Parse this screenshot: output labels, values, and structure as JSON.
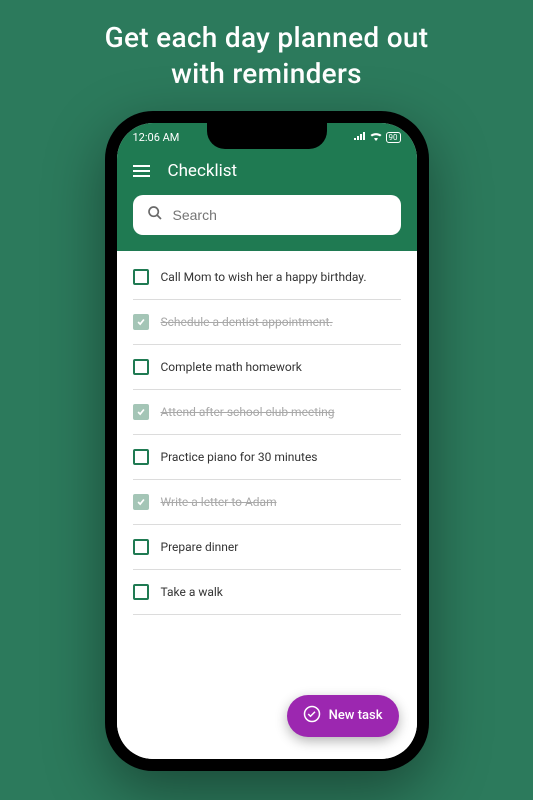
{
  "promo": {
    "line1": "Get each day planned out",
    "line2": "with reminders"
  },
  "statusBar": {
    "time": "12:06 AM",
    "battery": "90"
  },
  "header": {
    "title": "Checklist"
  },
  "search": {
    "placeholder": "Search"
  },
  "tasks": [
    {
      "label": "Call Mom to wish her a happy birthday.",
      "done": false
    },
    {
      "label": "Schedule a dentist appointment.",
      "done": true
    },
    {
      "label": "Complete math homework",
      "done": false
    },
    {
      "label": "Attend after school club meeting",
      "done": true
    },
    {
      "label": "Practice piano for 30 minutes",
      "done": false
    },
    {
      "label": "Write a letter to Adam",
      "done": true
    },
    {
      "label": "Prepare dinner",
      "done": false
    },
    {
      "label": "Take a walk",
      "done": false
    }
  ],
  "fab": {
    "label": "New task"
  }
}
